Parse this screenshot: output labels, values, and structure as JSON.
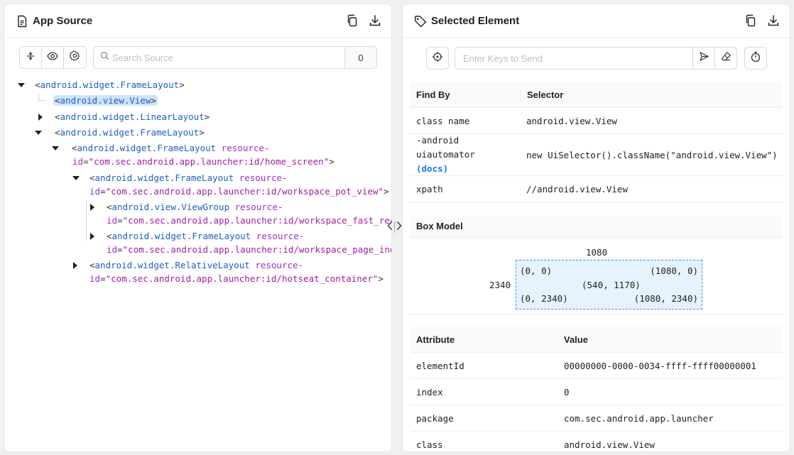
{
  "app_source": {
    "title": "App Source",
    "search_placeholder": "Search Source",
    "search_count": "0"
  },
  "tree": {
    "nodes": [
      {
        "tag": "android.widget.FrameLayout"
      },
      {
        "tag": "android.view.View"
      },
      {
        "tag": "android.widget.LinearLayout"
      },
      {
        "tag": "android.widget.FrameLayout"
      },
      {
        "tag": "android.widget.FrameLayout",
        "attr": "resource-",
        "attr2": "id",
        "value": "com.sec.android.app.launcher:id/home_screen"
      },
      {
        "tag": "android.widget.FrameLayout",
        "attr": "resource-",
        "attr2": "id",
        "value": "com.sec.android.app.launcher:id/workspace_pot_view"
      },
      {
        "tag": "android.view.ViewGroup",
        "attr": "resource-",
        "attr2": "id",
        "value": "com.sec.android.app.launcher:id/workspace_fast_recy"
      },
      {
        "tag": "android.widget.FrameLayout",
        "attr": "resource-",
        "attr2": "id",
        "value": "com.sec.android.app.launcher:id/workspace_page_indi"
      },
      {
        "tag": "android.widget.RelativeLayout",
        "attr": "resource-",
        "attr2": "id",
        "value": "com.sec.android.app.launcher:id/hotseat_container"
      }
    ]
  },
  "selected_element": {
    "title": "Selected Element",
    "keys_placeholder": "Enter Keys to Send"
  },
  "find_by": {
    "headers": [
      "Find By",
      "Selector"
    ],
    "rows": [
      {
        "by": "class name",
        "selector": "android.view.View"
      },
      {
        "by": "-android uiautomator",
        "docs": "(docs)",
        "selector": "new UiSelector().className(\"android.view.View\")"
      },
      {
        "by": "xpath",
        "selector": "//android.view.View"
      }
    ]
  },
  "box_model": {
    "title": "Box Model",
    "width": "1080",
    "height": "2340",
    "top_left": "(0, 0)",
    "top_right": "(1080, 0)",
    "center": "(540, 1170)",
    "bottom_left": "(0, 2340)",
    "bottom_right": "(1080, 2340)"
  },
  "attributes": {
    "headers": [
      "Attribute",
      "Value"
    ],
    "rows": [
      {
        "name": "elementId",
        "value": "00000000-0000-0034-ffff-ffff00000001"
      },
      {
        "name": "index",
        "value": "0"
      },
      {
        "name": "package",
        "value": "com.sec.android.app.launcher"
      },
      {
        "name": "class",
        "value": "android.view.View"
      }
    ]
  },
  "colors": {
    "tag": "#1f5fbf",
    "attr": "#9b2fc7",
    "value": "#a11ea3",
    "selected_bg": "#cfe4fa",
    "link": "#1677ff"
  },
  "icons": [
    "file-icon",
    "copy-icon",
    "download-icon",
    "tag-icon",
    "expand-icon",
    "eye-icon",
    "gear-icon",
    "search-icon",
    "target-icon",
    "send-icon",
    "eraser-icon",
    "timer-icon"
  ]
}
